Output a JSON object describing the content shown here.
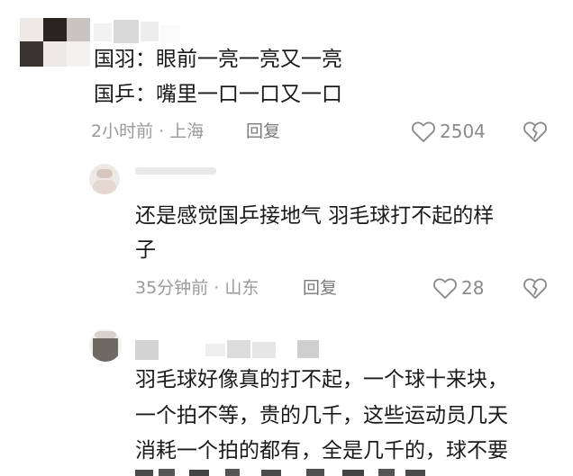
{
  "comments": [
    {
      "lines": [
        "国羽：眼前一亮一亮又一亮",
        "国乒：嘴里一口一口又一口"
      ],
      "time": "2小时前",
      "location": "上海",
      "reply_label": "回复",
      "likes": "2504",
      "like_icon": "heart-outline-icon",
      "dislike_icon": "broken-heart-icon"
    },
    {
      "lines": [
        "还是感觉国乒接地气    羽毛球打不起的样",
        "子"
      ],
      "time": "35分钟前",
      "location": "山东",
      "reply_label": "回复",
      "likes": "28",
      "like_icon": "heart-outline-icon",
      "dislike_icon": "broken-heart-icon"
    },
    {
      "lines": [
        "羽毛球好像真的打不起，一个球十来块，",
        "一个拍不等，贵的几千，这些运动员几天",
        "消耗一个拍的都有，全是几千的，球不要"
      ]
    }
  ],
  "separator": " · "
}
